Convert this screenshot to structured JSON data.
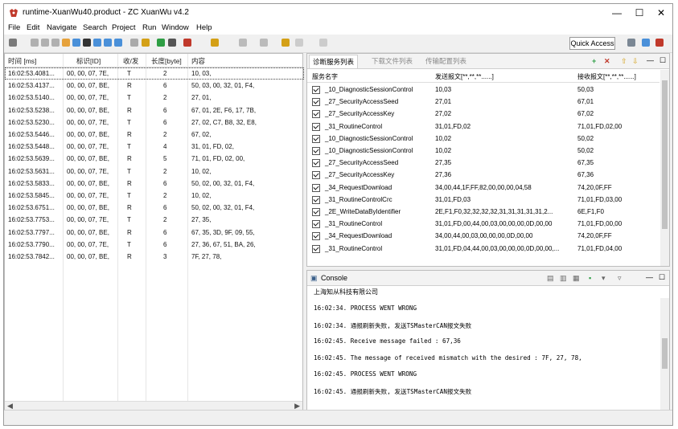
{
  "window": {
    "title": "runtime-XuanWu40.product - ZC XuanWu v4.2",
    "controls": [
      "—",
      "☐",
      "✕"
    ]
  },
  "menu": [
    "File",
    "Edit",
    "Navigate",
    "Search",
    "Project",
    "Run",
    "Window",
    "Help"
  ],
  "toolbar": {
    "quick_access": "Quick Access"
  },
  "trace": {
    "columns": [
      "时间 [ms]",
      "标识[ID]",
      "收/发",
      "长度[byte]",
      "内容"
    ],
    "rows": [
      [
        "16:02:53.4081...",
        "00, 00, 07, 7E,",
        "T",
        "2",
        "10, 03,"
      ],
      [
        "16:02:53.4137...",
        "00, 00, 07, BE,",
        "R",
        "6",
        "50, 03, 00, 32, 01, F4,"
      ],
      [
        "16:02:53.5140...",
        "00, 00, 07, 7E,",
        "T",
        "2",
        "27, 01,"
      ],
      [
        "16:02:53.5238...",
        "00, 00, 07, BE,",
        "R",
        "6",
        "67, 01, 2E, F6, 17, 7B,"
      ],
      [
        "16:02:53.5230...",
        "00, 00, 07, 7E,",
        "T",
        "6",
        "27, 02, C7, B8, 32, E8,"
      ],
      [
        "16:02:53.5446...",
        "00, 00, 07, BE,",
        "R",
        "2",
        "67, 02,"
      ],
      [
        "16:02:53.5448...",
        "00, 00, 07, 7E,",
        "T",
        "4",
        "31, 01, FD, 02,"
      ],
      [
        "16:02:53.5639...",
        "00, 00, 07, BE,",
        "R",
        "5",
        "71, 01, FD, 02, 00,"
      ],
      [
        "16:02:53.5631...",
        "00, 00, 07, 7E,",
        "T",
        "2",
        "10, 02,"
      ],
      [
        "16:02:53.5833...",
        "00, 00, 07, BE,",
        "R",
        "6",
        "50, 02, 00, 32, 01, F4,"
      ],
      [
        "16:02:53.5845...",
        "00, 00, 07, 7E,",
        "T",
        "2",
        "10, 02,"
      ],
      [
        "16:02:53.6751...",
        "00, 00, 07, BE,",
        "R",
        "6",
        "50, 02, 00, 32, 01, F4,"
      ],
      [
        "16:02:53.7753...",
        "00, 00, 07, 7E,",
        "T",
        "2",
        "27, 35,"
      ],
      [
        "16:02:53.7797...",
        "00, 00, 07, BE,",
        "R",
        "6",
        "67, 35, 3D, 9F, 09, 55,"
      ],
      [
        "16:02:53.7790...",
        "00, 00, 07, 7E,",
        "T",
        "6",
        "27, 36, 67, 51, BA, 26,"
      ],
      [
        "16:02:53.7842...",
        "00, 00, 07, BE,",
        "R",
        "3",
        "7F, 27, 78,"
      ]
    ]
  },
  "services": {
    "tabs": [
      "诊断服务列表",
      "下载文件列表",
      "传输配置列表"
    ],
    "columns": [
      "服务名字",
      "发送报文[**,**,**......]",
      "接收报文[**,**,**......]"
    ],
    "rows": [
      [
        "_10_DiagnosticSessionControl",
        "10,03",
        "50,03"
      ],
      [
        "_27_SecurityAccessSeed",
        "27,01",
        "67,01"
      ],
      [
        "_27_SecurityAccessKey",
        "27,02",
        "67,02"
      ],
      [
        "_31_RoutineControl",
        "31,01,FD,02",
        "71,01,FD,02,00"
      ],
      [
        "_10_DiagnosticSessionControl",
        "10,02",
        "50,02"
      ],
      [
        "_10_DiagnosticSessionControl",
        "10,02",
        "50,02"
      ],
      [
        "_27_SecurityAccessSeed",
        "27,35",
        "67,35"
      ],
      [
        "_27_SecurityAccessKey",
        "27,36",
        "67,36"
      ],
      [
        "_34_RequestDownload",
        "34,00,44,1F,FF,82,00,00,00,04,58",
        "74,20,0F,FF"
      ],
      [
        "_31_RoutineControlCrc",
        "31,01,FD,03",
        "71,01,FD,03,00"
      ],
      [
        "_2E_WriteDataByIdentifier",
        "2E,F1,F0,32,32,32,32,31,31,31,31,31,2...",
        "6E,F1,F0"
      ],
      [
        "_31_RoutineControl",
        "31,01,FD,00,44,00,03,00,00,00,0D,00,00",
        "71,01,FD,00,00"
      ],
      [
        "_34_RequestDownload",
        "34,00,44,00,03,00,00,00,0D,00,00",
        "74,20,0F,FF"
      ],
      [
        "_31_RoutineControl",
        "31,01,FD,04,44,00,03,00,00,00,0D,00,00,...",
        "71,01,FD,04,00"
      ]
    ]
  },
  "console": {
    "title": "Console",
    "company": "上海知从科技有限公司",
    "lines": [
      "16:02:34.    PROCESS WENT WRONG",
      "16:02:34.    通报刷新失败, 发送TSMasterCAN报文失败",
      "16:02:45.    Receive message failed : 67,36",
      "16:02:45.    The message of received mismatch with the desired : 7F, 27, 78,",
      "16:02:45.    PROCESS WENT WRONG",
      "16:02:45.    通报刷新失败, 发送TSMasterCAN报文失败"
    ]
  }
}
